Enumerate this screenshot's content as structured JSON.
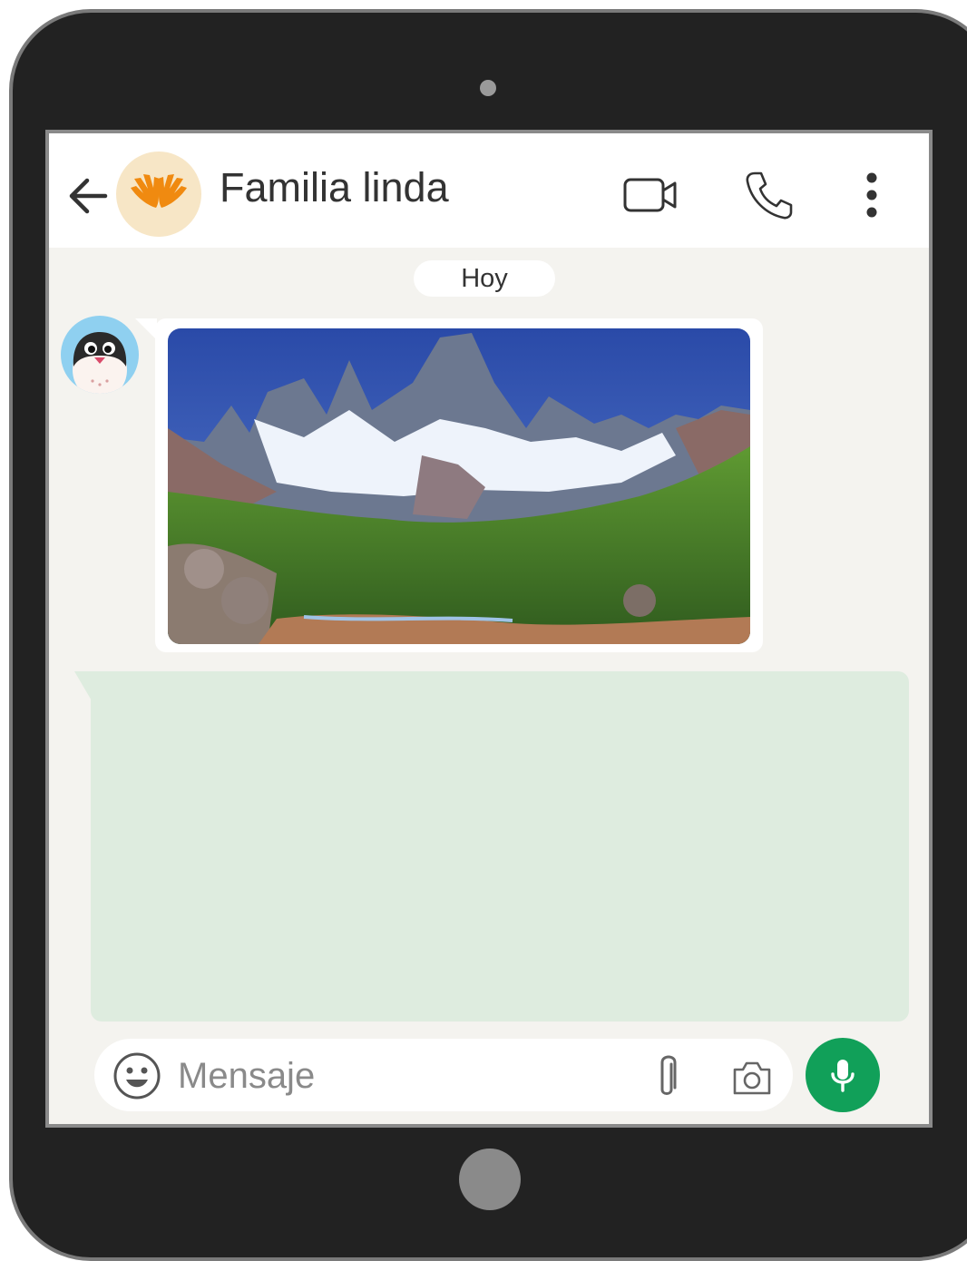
{
  "chat": {
    "title": "Familia linda",
    "date_separator": "Hoy",
    "image_message_alt": "Mountain landscape",
    "input_placeholder": "Mensaje"
  },
  "icons": {
    "back": "arrow-left-icon",
    "video": "video-camera-icon",
    "call": "phone-icon",
    "menu": "more-vertical-icon",
    "emoji": "smiley-icon",
    "attach": "paperclip-icon",
    "camera": "camera-icon",
    "mic": "microphone-icon"
  },
  "colors": {
    "accent": "#11a059",
    "outgoing_bubble": "#deecdf",
    "chat_background": "#f4f3ef",
    "group_avatar_bg": "#f7e6c6",
    "sender_avatar_bg": "#8fd0f0"
  }
}
